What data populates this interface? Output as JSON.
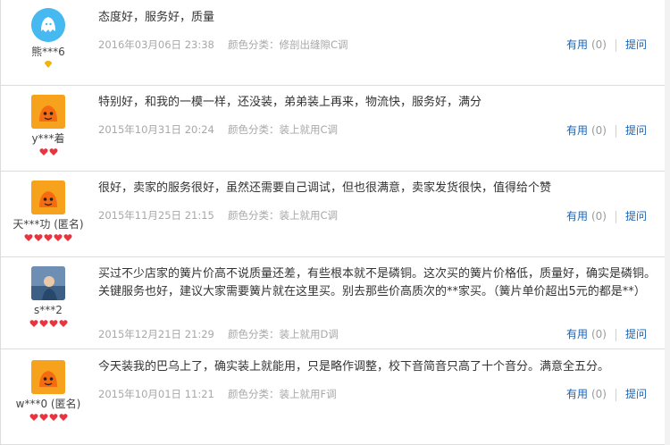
{
  "reviews": [
    {
      "user": "熊***6",
      "badge": "diamond",
      "hearts": 0,
      "avatar": "blue-ghost-avatar",
      "text": "态度好，服务好，质量",
      "date": "2016年03月06日 23:38",
      "color_class": "颜色分类：修剖出缝隙C调",
      "useful_label": "有用",
      "useful_count": "(0)",
      "ask_label": "提问"
    },
    {
      "user": "y***着",
      "badge": "hearts",
      "hearts": 2,
      "avatar": "orange-mascot-avatar",
      "text": "特别好，和我的一模一样，还没装，弟弟装上再来，物流快，服务好，满分",
      "date": "2015年10月31日 20:24",
      "color_class": "颜色分类：装上就用C调",
      "useful_label": "有用",
      "useful_count": "(0)",
      "ask_label": "提问"
    },
    {
      "user": "天***功 (匿名)",
      "badge": "hearts",
      "hearts": 5,
      "avatar": "orange-mascot-avatar",
      "text": "很好，卖家的服务很好，虽然还需要自己调试，但也很满意，卖家发货很快，值得给个赞",
      "date": "2015年11月25日 21:15",
      "color_class": "颜色分类：装上就用C调",
      "useful_label": "有用",
      "useful_count": "(0)",
      "ask_label": "提问"
    },
    {
      "user": "s***2",
      "badge": "hearts",
      "hearts": 4,
      "avatar": "photo-avatar",
      "text": "买过不少店家的簧片价高不说质量还差，有些根本就不是磷铜。这次买的簧片价格低，质量好，确实是磷铜。关键服务也好，建议大家需要簧片就在这里买。别去那些价高质次的**家买。（簧片单价超出5元的都是**）",
      "date": "2015年12月21日 21:29",
      "color_class": "颜色分类：装上就用D调",
      "useful_label": "有用",
      "useful_count": "(0)",
      "ask_label": "提问"
    },
    {
      "user": "w***0 (匿名)",
      "badge": "hearts",
      "hearts": 4,
      "avatar": "orange-mascot-avatar",
      "text": "今天装我的巴乌上了，确实装上就能用，只是略作调整，校下音简音只高了十个音分。满意全五分。",
      "date": "2015年10月01日 11:21",
      "color_class": "颜色分类：装上就用F调",
      "useful_label": "有用",
      "useful_count": "(0)",
      "ask_label": "提问"
    }
  ],
  "colors": {
    "link": "#1a64b4",
    "meta": "#a8a8a8",
    "heart": "#e8343f",
    "divider": "#dcdcdc"
  }
}
